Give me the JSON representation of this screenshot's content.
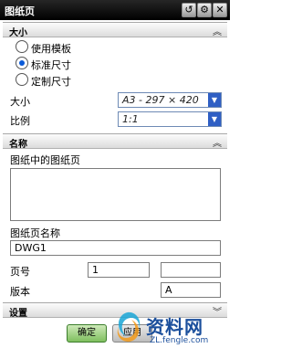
{
  "window": {
    "title": "图纸页"
  },
  "titlebar_icons": [
    "reset-icon",
    "gear-icon",
    "close-icon"
  ],
  "size_section": {
    "header": "大小",
    "options": [
      {
        "label": "使用模板",
        "selected": false
      },
      {
        "label": "标准尺寸",
        "selected": true
      },
      {
        "label": "定制尺寸",
        "selected": false
      }
    ],
    "size_label": "大小",
    "size_value": "A3 - 297 × 420",
    "scale_label": "比例",
    "scale_value": "1:1"
  },
  "name_section": {
    "header": "名称",
    "sheets_label": "图纸中的图纸页",
    "sheet_name_label": "图纸页名称",
    "sheet_name_value": "DWG1",
    "page_label": "页号",
    "page_value": "1",
    "page_value2": "",
    "revision_label": "版本",
    "revision_value": "A"
  },
  "settings_section": {
    "header": "设置"
  },
  "buttons": {
    "ok": "确定",
    "apply": "应用"
  },
  "watermark": {
    "text": "资料网",
    "url": "ZL.fengle.com"
  },
  "colors": {
    "titlebar": "#000000",
    "selection": "#2f5fc4",
    "button": "#7fbf5f"
  }
}
